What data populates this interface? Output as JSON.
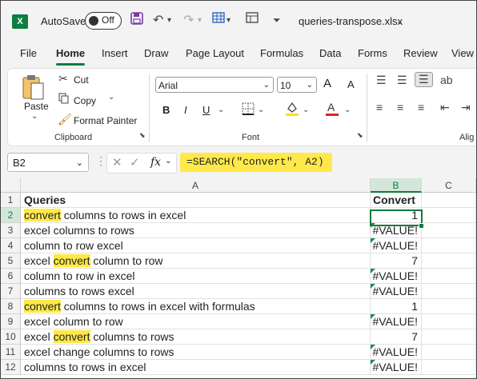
{
  "titlebar": {
    "app_logo": "X",
    "autosave_label": "AutoSave",
    "autosave_state": "Off",
    "filename": "queries-transpose.xlsx",
    "icons": [
      "save-icon",
      "undo-icon",
      "redo-icon",
      "table-icon",
      "sheet-view-icon",
      "customize-icon",
      "chevron-down-icon"
    ]
  },
  "tabs": [
    "File",
    "Home",
    "Insert",
    "Draw",
    "Page Layout",
    "Formulas",
    "Data",
    "Forms",
    "Review",
    "View"
  ],
  "active_tab": "Home",
  "ribbon": {
    "clipboard": {
      "paste": "Paste",
      "cut": "Cut",
      "copy": "Copy",
      "format_painter": "Format Painter",
      "label": "Clipboard"
    },
    "font": {
      "name": "Arial",
      "size": "10",
      "bold": "B",
      "italic": "I",
      "underline": "U",
      "grow": "A",
      "shrink": "A",
      "label": "Font"
    },
    "alignment": {
      "label": "Alig"
    }
  },
  "formula_bar": {
    "name_box": "B2",
    "fx": "fx",
    "formula": "=SEARCH(\"convert\", A2)"
  },
  "grid": {
    "columns": [
      "A",
      "B",
      "C"
    ],
    "selected_column": "B",
    "selected_row": "2",
    "active_cell": "B2",
    "highlight_color": "#ffe94a",
    "error_marker_color": "#1e8c4e",
    "rows": [
      {
        "n": "1",
        "a": [
          {
            "t": "Queries",
            "h": false
          }
        ],
        "b": "Convert",
        "header": true,
        "err": false
      },
      {
        "n": "2",
        "a": [
          {
            "t": "convert",
            "h": true
          },
          {
            "t": " columns to rows in excel",
            "h": false
          }
        ],
        "b": "1",
        "header": false,
        "err": false
      },
      {
        "n": "3",
        "a": [
          {
            "t": "excel columns to rows",
            "h": false
          }
        ],
        "b": "#VALUE!",
        "header": false,
        "err": true
      },
      {
        "n": "4",
        "a": [
          {
            "t": "column to row excel",
            "h": false
          }
        ],
        "b": "#VALUE!",
        "header": false,
        "err": true
      },
      {
        "n": "5",
        "a": [
          {
            "t": "excel ",
            "h": false
          },
          {
            "t": "convert",
            "h": true
          },
          {
            "t": " column to row",
            "h": false
          }
        ],
        "b": "7",
        "header": false,
        "err": false
      },
      {
        "n": "6",
        "a": [
          {
            "t": "column to row in excel",
            "h": false
          }
        ],
        "b": "#VALUE!",
        "header": false,
        "err": true
      },
      {
        "n": "7",
        "a": [
          {
            "t": "columns to rows excel",
            "h": false
          }
        ],
        "b": "#VALUE!",
        "header": false,
        "err": true
      },
      {
        "n": "8",
        "a": [
          {
            "t": "convert",
            "h": true
          },
          {
            "t": " columns to rows in excel with formulas",
            "h": false
          }
        ],
        "b": "1",
        "header": false,
        "err": false
      },
      {
        "n": "9",
        "a": [
          {
            "t": "excel column to row",
            "h": false
          }
        ],
        "b": "#VALUE!",
        "header": false,
        "err": true
      },
      {
        "n": "10",
        "a": [
          {
            "t": "excel ",
            "h": false
          },
          {
            "t": "convert",
            "h": true
          },
          {
            "t": " columns to rows",
            "h": false
          }
        ],
        "b": "7",
        "header": false,
        "err": false
      },
      {
        "n": "11",
        "a": [
          {
            "t": "excel change columns to rows",
            "h": false
          }
        ],
        "b": "#VALUE!",
        "header": false,
        "err": true
      },
      {
        "n": "12",
        "a": [
          {
            "t": "columns to rows in excel",
            "h": false
          }
        ],
        "b": "#VALUE!",
        "header": false,
        "err": true
      }
    ]
  }
}
